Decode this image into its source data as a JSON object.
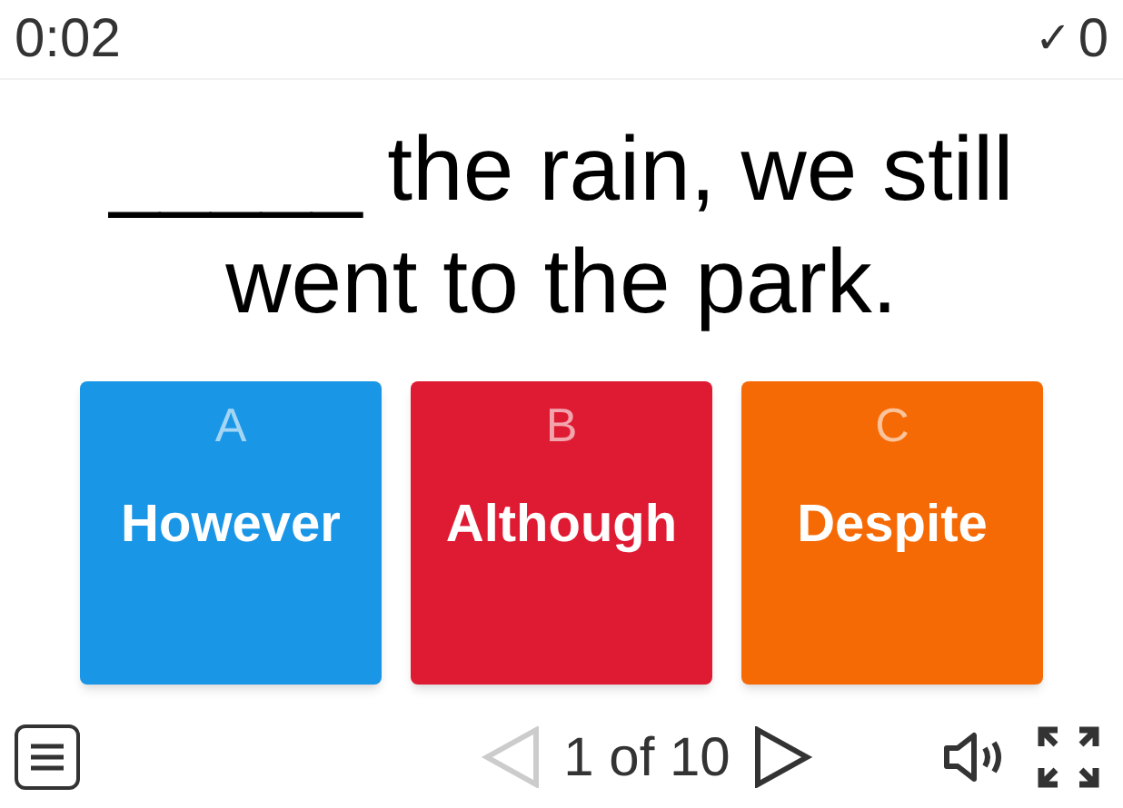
{
  "timer": "0:02",
  "score": {
    "mark": "✓",
    "count": "0"
  },
  "question": "_____ the rain, we still went to the park.",
  "options": [
    {
      "letter": "A",
      "label": "However",
      "color": "#1a96e6"
    },
    {
      "letter": "B",
      "label": "Although",
      "color": "#df1b33"
    },
    {
      "letter": "C",
      "label": "Despite",
      "color": "#f66a06"
    }
  ],
  "pager": {
    "text": "1 of 10",
    "prev_disabled": true,
    "next_disabled": false
  }
}
